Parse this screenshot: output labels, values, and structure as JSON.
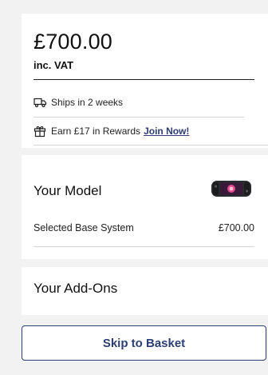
{
  "price": {
    "amount": "£700.00",
    "vat_note": "inc. VAT"
  },
  "shipping": {
    "icon": "truck-icon",
    "text": "Ships in 2 weeks"
  },
  "rewards": {
    "icon": "gift-icon",
    "text": "Earn £17 in Rewards",
    "link_label": "Join Now!"
  },
  "model": {
    "title": "Your Model",
    "image": "handheld-device-image",
    "base_label": "Selected Base System",
    "base_price": "£700.00"
  },
  "addons": {
    "title": "Your Add-Ons"
  },
  "actions": {
    "skip_label": "Skip to Basket"
  },
  "colors": {
    "accent": "#2c3e73",
    "background": "#f2f2f2",
    "card": "#ffffff"
  }
}
